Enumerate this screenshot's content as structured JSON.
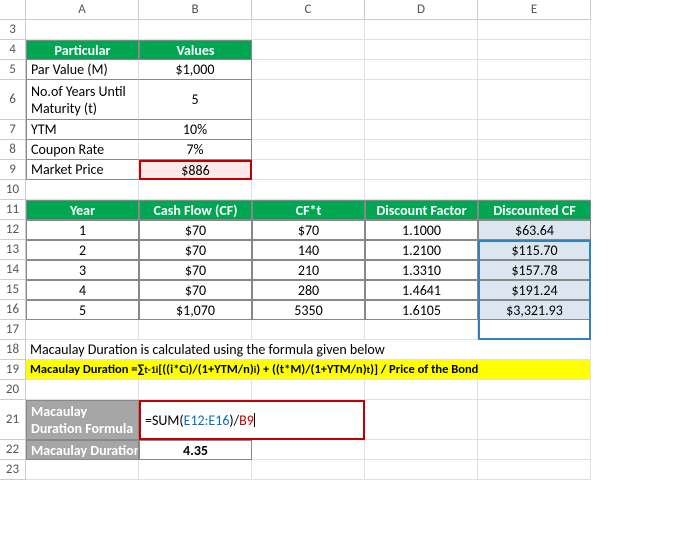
{
  "columns": [
    "A",
    "B",
    "C",
    "D",
    "E"
  ],
  "rows": [
    "3",
    "4",
    "5",
    "6",
    "7",
    "8",
    "9",
    "10",
    "11",
    "12",
    "13",
    "14",
    "15",
    "16",
    "17",
    "18",
    "19",
    "20",
    "21",
    "22",
    "23"
  ],
  "t1": {
    "h_particular": "Particular",
    "h_values": "Values",
    "r1l": "Par Value (M)",
    "r1v": "$1,000",
    "r2l": "No.of Years Until Maturity (t)",
    "r2v": "5",
    "r3l": "YTM",
    "r3v": "10%",
    "r4l": "Coupon Rate",
    "r4v": "7%",
    "r5l": "Market Price",
    "r5v": "$886"
  },
  "t2": {
    "h1": "Year",
    "h2": "Cash Flow (CF)",
    "h3": "CF*t",
    "h4": "Discount Factor",
    "h5": "Discounted CF",
    "rows": [
      {
        "y": "1",
        "cf": "$70",
        "cft": "$70",
        "df": "1.1000",
        "dcf": "$63.64"
      },
      {
        "y": "2",
        "cf": "$70",
        "cft": "140",
        "df": "1.2100",
        "dcf": "$115.70"
      },
      {
        "y": "3",
        "cf": "$70",
        "cft": "210",
        "df": "1.3310",
        "dcf": "$157.78"
      },
      {
        "y": "4",
        "cf": "$70",
        "cft": "280",
        "df": "1.4641",
        "dcf": "$191.24"
      },
      {
        "y": "5",
        "cf": "$1,070",
        "cft": "5350",
        "df": "1.6105",
        "dcf": "$3,321.93"
      }
    ]
  },
  "note": "Macaulay Duration is calculated using the formula given below",
  "formula_text_prefix": "Macaulay Duration = ",
  "formula_text_sum": "∑",
  "formula_text_body": " [((i*C",
  "formula_text_body2": ")/(1+YTM/n)",
  "formula_text_body3": ") + ((t*M)/(1+YTM/n)",
  "formula_text_body4": ")] / Price of the Bond",
  "formula_sup1": "t-1",
  "formula_sub1": "i",
  "formula_sub2": "i",
  "formula_sup2": "i",
  "formula_sup3": "t",
  "result": {
    "lbl_formula": "Macaulay Duration Formula",
    "lbl_value": "Macaulay Duration",
    "cell_formula_eq": "=SUM(",
    "cell_formula_range": "E12:E16",
    "cell_formula_mid": ")/",
    "cell_formula_ref": "B9",
    "value": "4.35"
  }
}
